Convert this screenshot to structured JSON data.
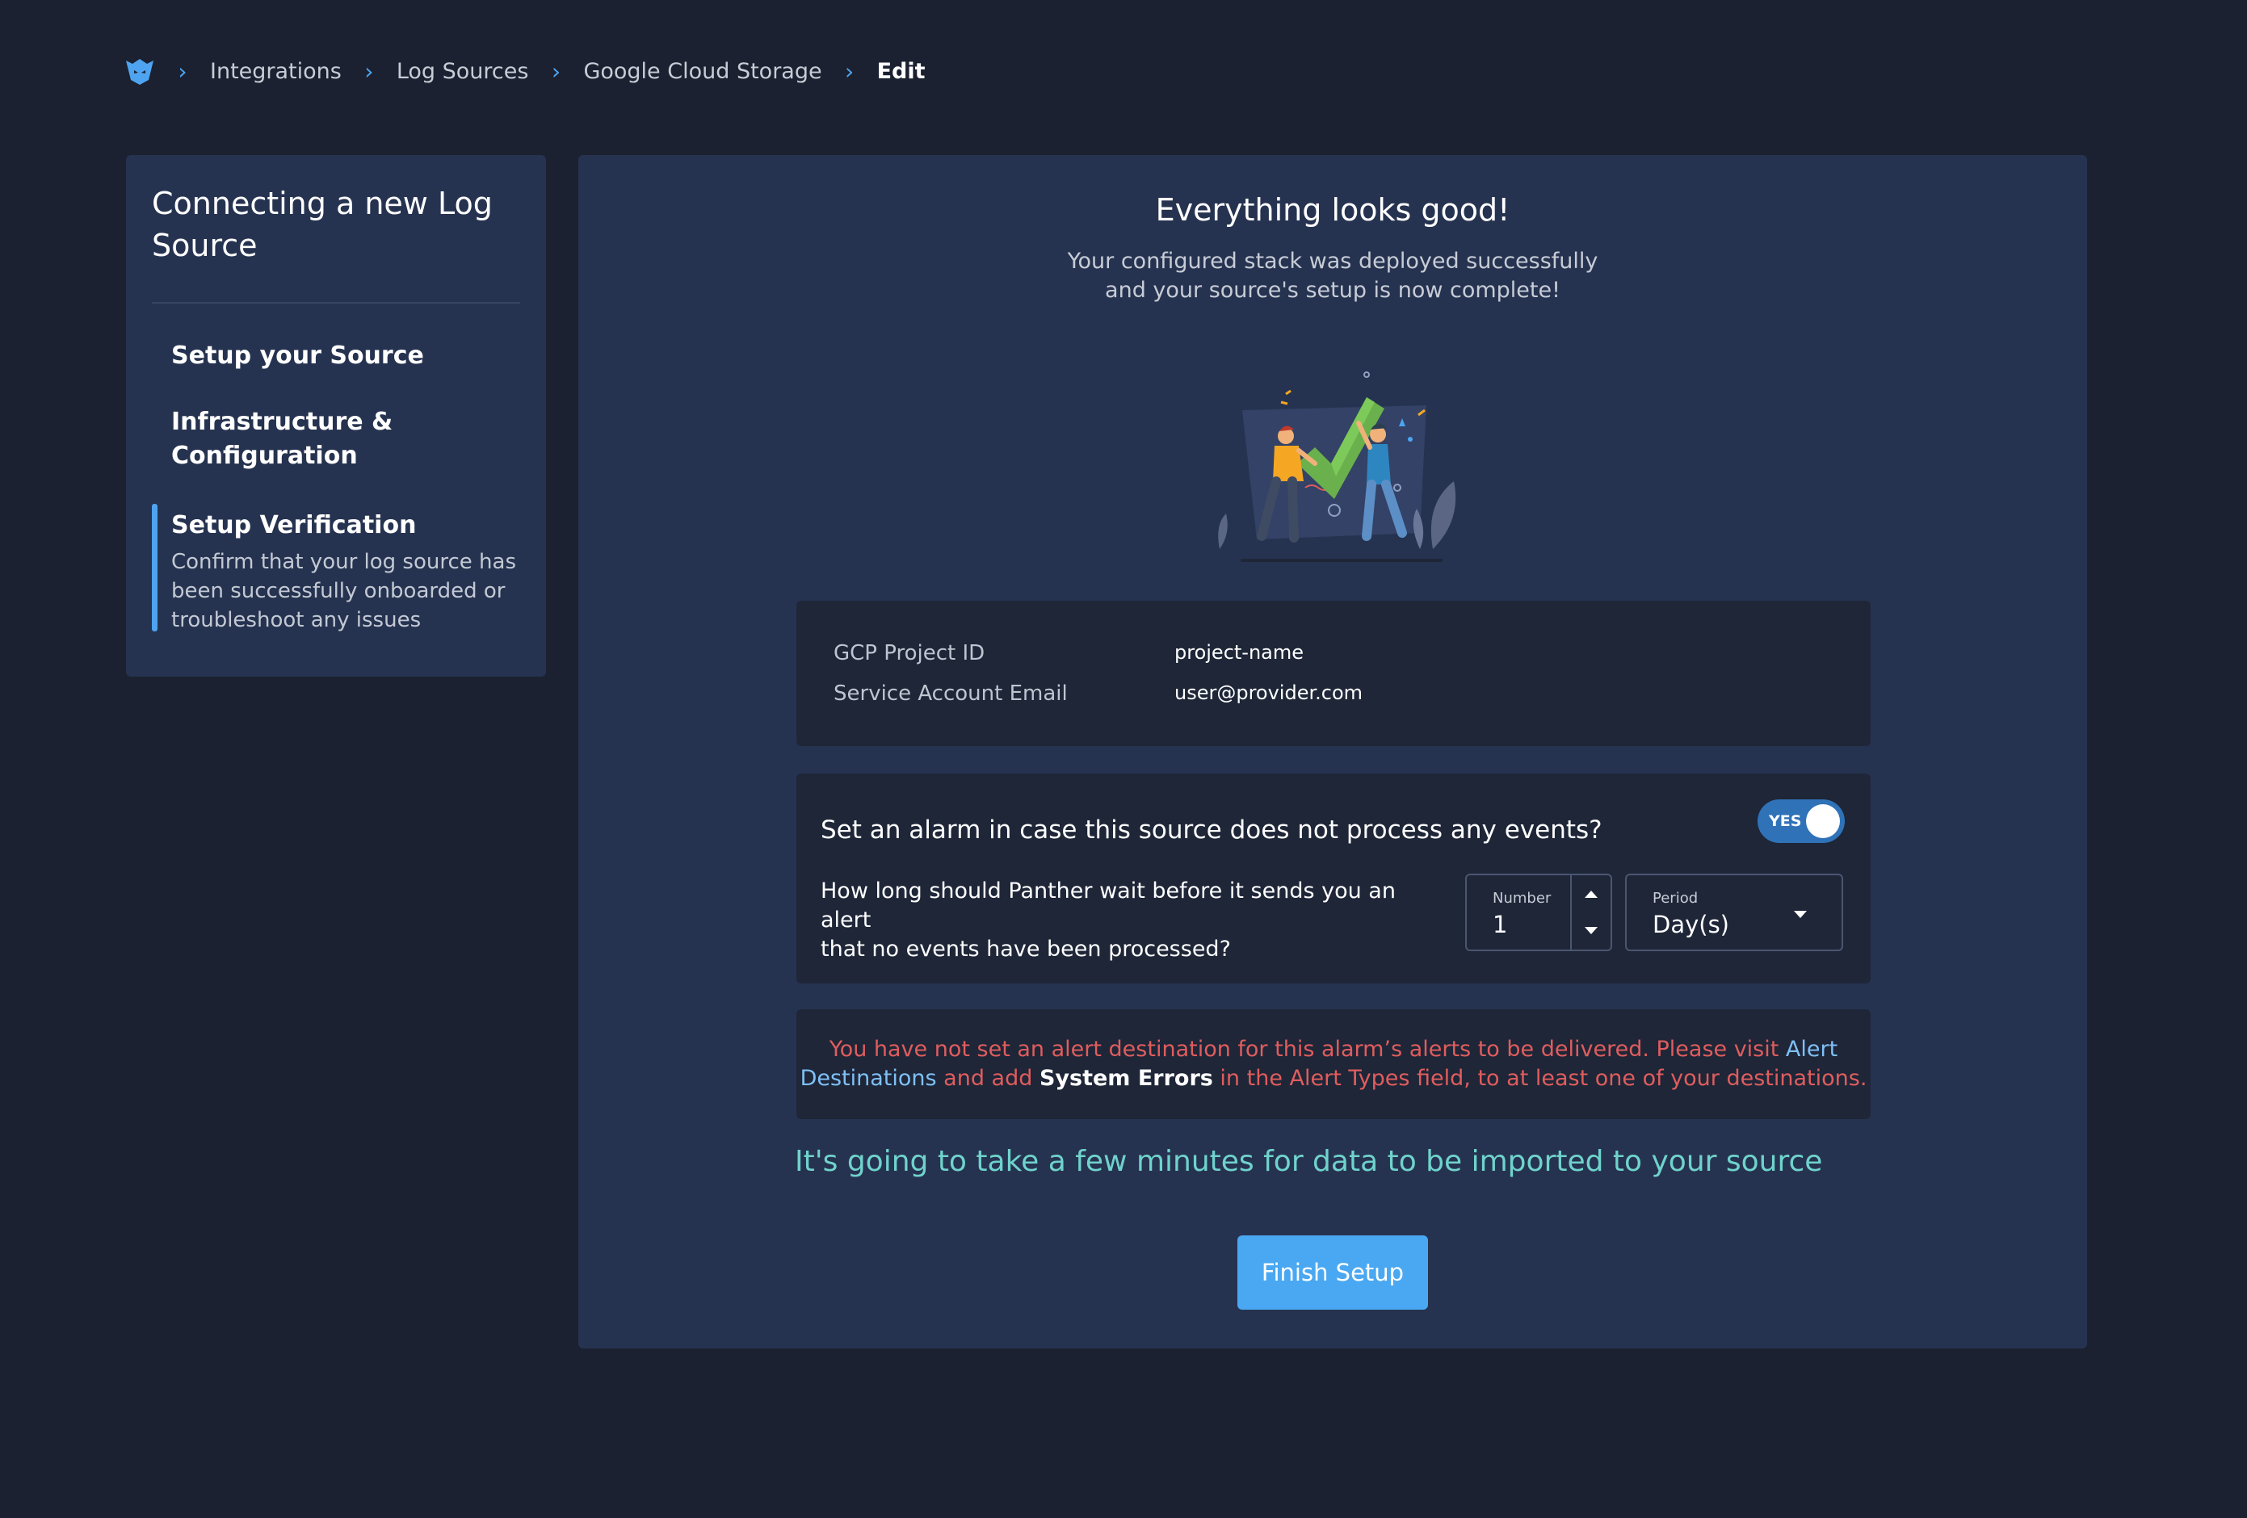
{
  "breadcrumb": {
    "items": [
      "Integrations",
      "Log Sources",
      "Google Cloud Storage"
    ],
    "current": "Edit"
  },
  "sidebar": {
    "title_line1": "Connecting a new Log",
    "title_line2": "Source",
    "steps": [
      {
        "label": "Setup your Source"
      },
      {
        "label_line1": "Infrastructure &",
        "label_line2": "Configuration"
      },
      {
        "label": "Setup Verification",
        "desc_line1": "Confirm that your log source has",
        "desc_line2": "been successfully onboarded or",
        "desc_line3": "troubleshoot any issues"
      }
    ]
  },
  "main": {
    "title": "Everything looks good!",
    "subtitle_line1": "Your configured stack was deployed successfully",
    "subtitle_line2": "and your source's setup is now complete!",
    "details": [
      {
        "label": "GCP Project ID",
        "value": "project-name"
      },
      {
        "label": "Service Account Email",
        "value": "user@provider.com"
      }
    ],
    "alarm": {
      "question": "Set an alarm in case this source does not process any events?",
      "toggle_label": "YES",
      "help_line1": "How long should Panther wait before it sends you an alert",
      "help_line2": "that no events have been processed?",
      "number_label": "Number",
      "number_value": "1",
      "period_label": "Period",
      "period_value": "Day(s)"
    },
    "warning": {
      "text1": "You have not set an alert destination for this alarm’s alerts to be delivered. Please visit ",
      "link": "Alert Destinations",
      "text2": " and add ",
      "strong": "System Errors",
      "text3": " in the Alert Types field, to at least one of your destinations."
    },
    "import_note": "It's going to take a few minutes for data to be imported to your source",
    "finish_button": "Finish Setup"
  },
  "colors": {
    "background": "#1b2130",
    "panel": "#263350",
    "inner_box": "#1e2638",
    "accent": "#4aa8f2",
    "warning": "#e05d5d",
    "note": "#6fd3cc"
  }
}
